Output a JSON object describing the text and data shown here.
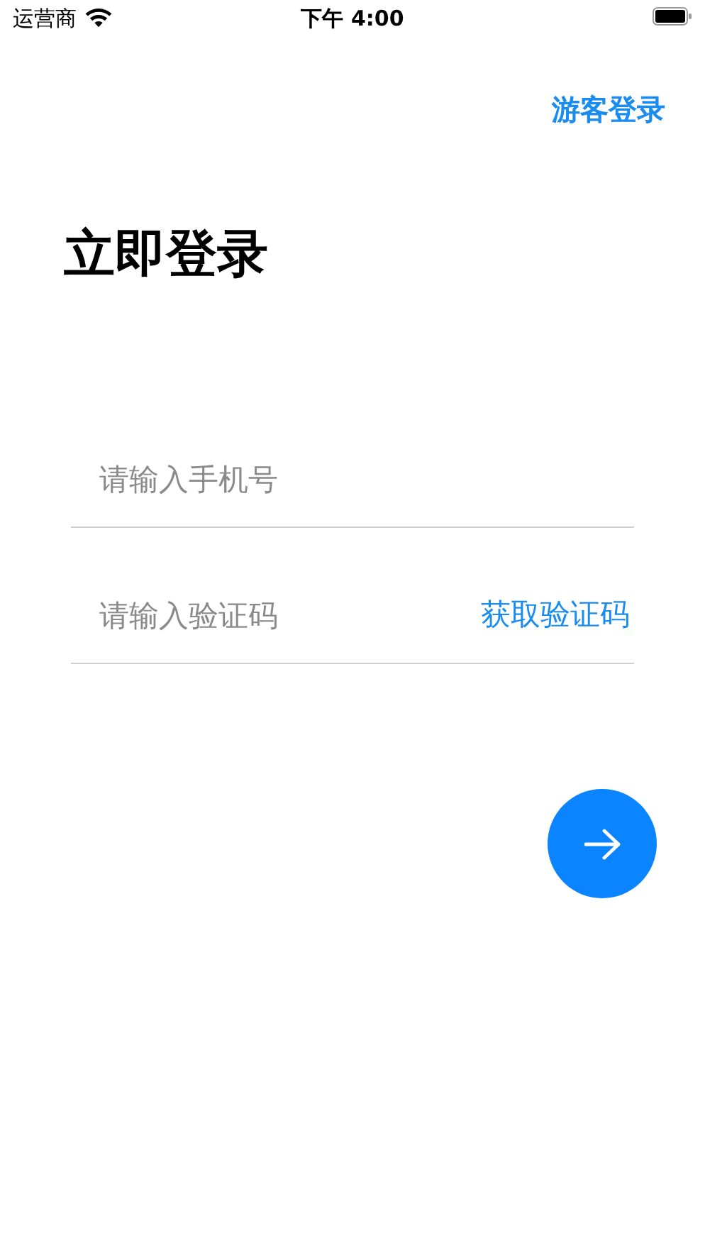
{
  "status_bar": {
    "carrier": "运营商",
    "time": "下午 4:00"
  },
  "guest_login": "游客登录",
  "title": "立即登录",
  "phone_field": {
    "placeholder": "请输入手机号"
  },
  "code_field": {
    "placeholder": "请输入验证码",
    "action": "获取验证码"
  }
}
